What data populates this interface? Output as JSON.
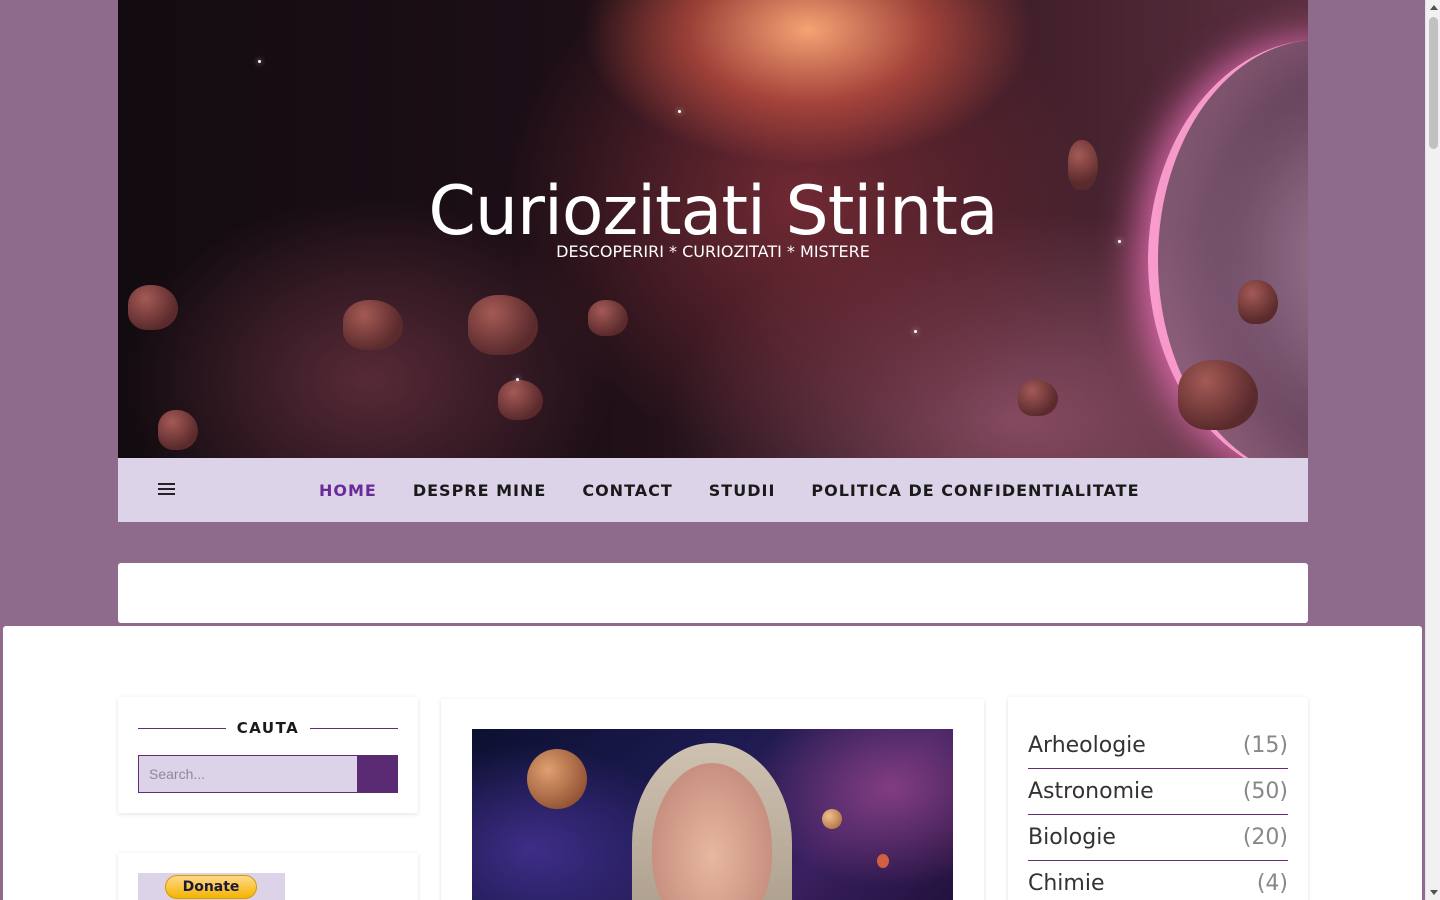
{
  "site": {
    "title": "Curiozitati Stiinta",
    "tagline": "DESCOPERIRI * CURIOZITATI * MISTERE"
  },
  "nav": {
    "items": [
      {
        "label": "HOME",
        "active": true
      },
      {
        "label": "DESPRE MINE"
      },
      {
        "label": "CONTACT"
      },
      {
        "label": "STUDII"
      },
      {
        "label": "POLITICA DE CONFIDENTIALITATE"
      }
    ]
  },
  "search_widget": {
    "title": "CAUTA",
    "placeholder": "Search..."
  },
  "donate_widget": {
    "button_label": "Donate"
  },
  "categories": [
    {
      "name": "Arheologie",
      "count": "(15)"
    },
    {
      "name": "Astronomie",
      "count": "(50)"
    },
    {
      "name": "Biologie",
      "count": "(20)"
    },
    {
      "name": "Chimie",
      "count": "(4)"
    }
  ],
  "colors": {
    "page_background": "#8e6b8c",
    "nav_background": "#dcd3e8",
    "accent": "#6a2a7a",
    "active_nav": "#6a2a9a",
    "search_button": "#5a2a72"
  },
  "icons": {
    "menu": "hamburger-icon",
    "search": "search-icon"
  }
}
